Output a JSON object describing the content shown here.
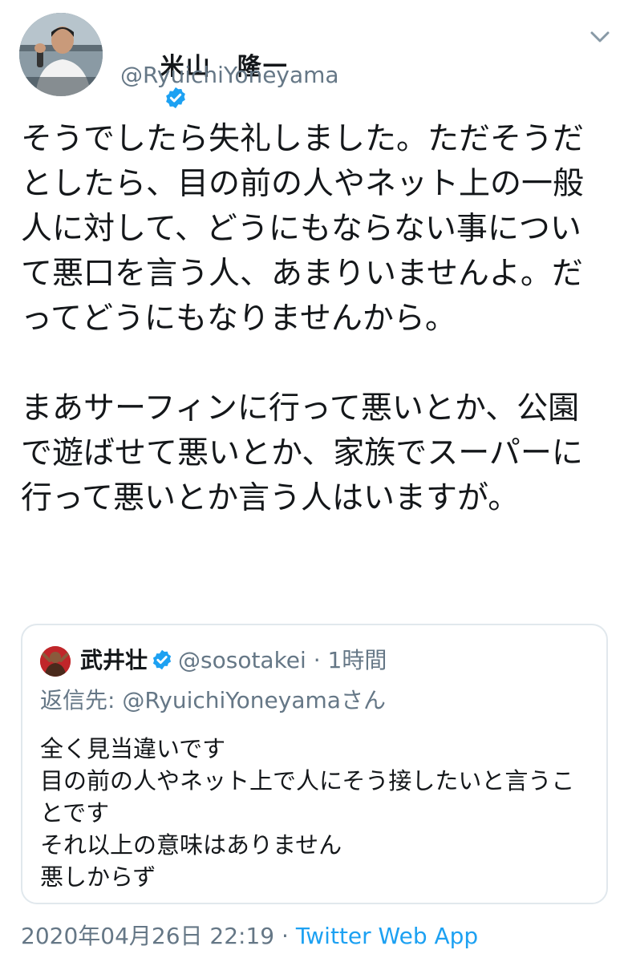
{
  "author": {
    "name": "米山　隆一",
    "handle": "@RyuichiYoneyama",
    "verified_color": "#1da1f2"
  },
  "menu": {
    "icon": "chevron-down-icon"
  },
  "tweet": {
    "paragraphs": [
      "そうでしたら失礼しました。ただそうだとしたら、目の前の人やネット上の一般人に対して、どうにもならない事について悪口を言う人、あまりいませんよ。だってどうにもなりませんから。",
      "まあサーフィンに行って悪いとか、公園で遊ばせて悪いとか、家族でスーパーに行って悪いとか言う人はいますが。"
    ]
  },
  "quote": {
    "name": "武井壮",
    "handle": "@sosotakei",
    "separator": "·",
    "time": "1時間",
    "reply_prefix": "返信先: ",
    "reply_to": "@RyuichiYoneyama",
    "reply_suffix": "さん",
    "text": "全く見当違いです\n目の前の人やネット上で人にそう接したいと言うことです\nそれ以上の意味はありません\n悪しからず"
  },
  "footer": {
    "date": "2020年04月26日 22:19",
    "separator": " · ",
    "source": "Twitter Web App"
  },
  "colors": {
    "text": "#14171a",
    "secondary": "#657786",
    "link": "#1da1f2",
    "border": "#e1e8ed"
  }
}
